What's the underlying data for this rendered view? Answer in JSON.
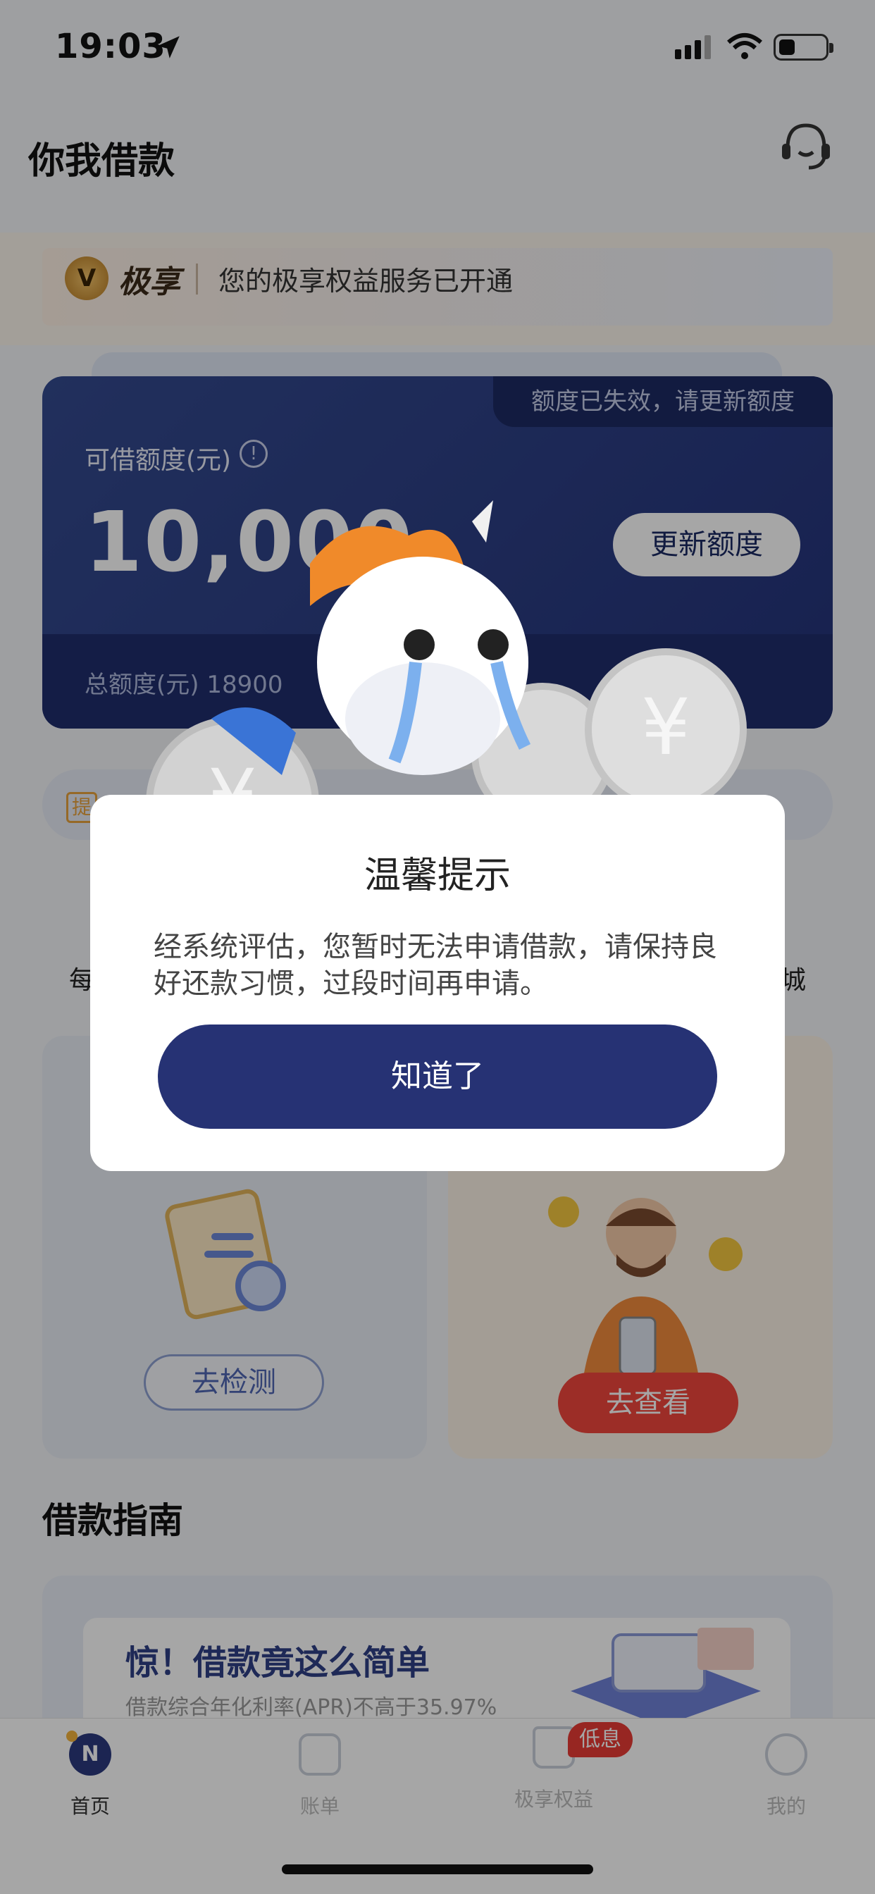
{
  "status_bar": {
    "time": "19:03"
  },
  "header": {
    "title": "你我借款"
  },
  "vip_banner": {
    "badge": "V",
    "brand": "极享",
    "text": "您的极享权益服务已开通"
  },
  "credit_card": {
    "expired_notice": "额度已失效，请更新额度",
    "limit_label": "可借额度(元)",
    "limit_value": "10,000",
    "update_button": "更新额度",
    "total_label": "总额度(元) 18900"
  },
  "background": {
    "tip_tag": "提",
    "side_left": "每",
    "side_right": "城",
    "detect_button": "去检测",
    "view_button": "去查看",
    "guide_title": "借款指南",
    "guide_headline": "惊！借款竟这么简单",
    "guide_sub": "借款综合年化利率(APR)不高于35.97%"
  },
  "tab_bar": {
    "tabs": [
      {
        "label": "首页",
        "icon": "home-icon"
      },
      {
        "label": "账单",
        "icon": "bill-icon"
      },
      {
        "label": "极享权益",
        "icon": "crown-icon"
      },
      {
        "label": "我的",
        "icon": "profile-icon"
      }
    ],
    "badge": "低息",
    "home_icon_letter": "N"
  },
  "dialog": {
    "title": "温馨提示",
    "message": "经系统评估，您暂时无法申请借款，请保持良好还款习惯，过段时间再申请。",
    "ok_button": "知道了"
  }
}
